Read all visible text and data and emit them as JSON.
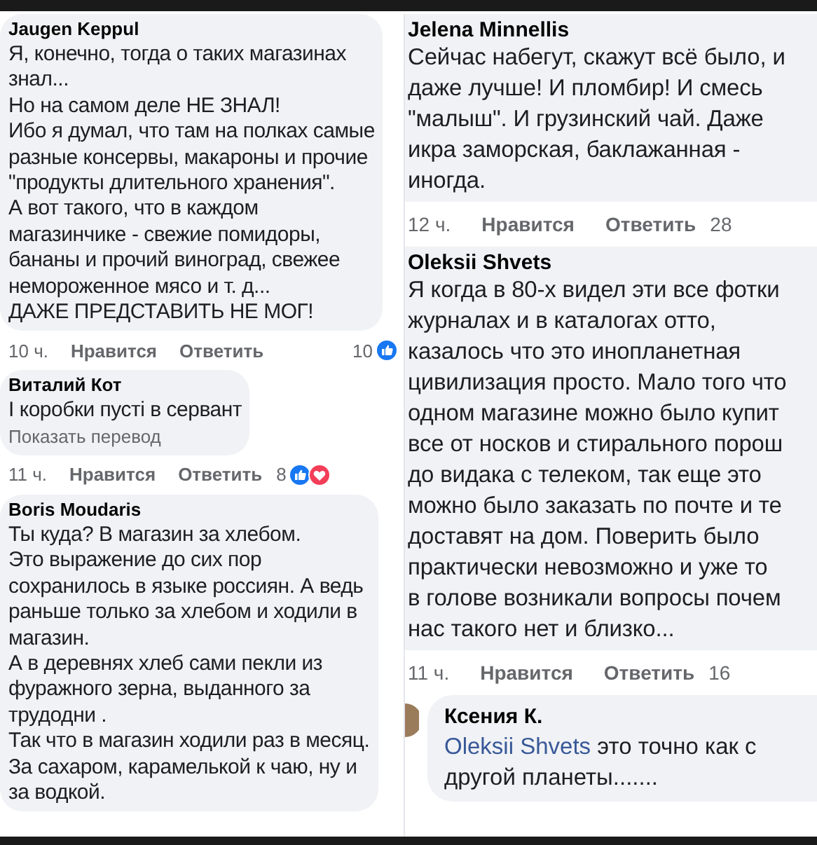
{
  "left": {
    "comments": [
      {
        "author": "Jaugen Keppul",
        "lines": [
          "Я, конечно, тогда о таких магазинах",
          "знал...",
          "Но на самом деле НЕ ЗНАЛ!",
          "Ибо я думал, что там на полках самые",
          "разные консервы, макароны и прочие",
          "\"продукты длительного хранения\".",
          "А вот такого, что в каждом",
          "магазинчике - свежие помидоры,",
          "бананы и прочий виноград, свежее",
          "немороженное мясо и т. д...",
          "ДАЖЕ ПРЕДСТАВИТЬ НЕ МОГ!"
        ],
        "meta": {
          "time": "10 ч.",
          "like": "Нравится",
          "reply": "Ответить",
          "count": "10"
        },
        "reactions": [
          {
            "kind": "like"
          }
        ]
      },
      {
        "author": "Виталий Кот",
        "lines": [
          "І коробки пусті в сервант"
        ],
        "translate": "Показать перевод",
        "meta": {
          "time": "11 ч.",
          "like": "Нравится",
          "reply": "Ответить",
          "count": "8"
        },
        "reactions": [
          {
            "kind": "like"
          },
          {
            "kind": "love"
          }
        ]
      },
      {
        "author": "Boris Moudaris",
        "lines": [
          "Ты куда? В магазин за хлебом.",
          "Это выражение до сих пор",
          "сохранилось в языке россиян. А ведь",
          "раньше только за хлебом и ходили в",
          "магазин.",
          "А в деревнях хлеб сами пекли из",
          "фуражного зерна, выданного за",
          "трудодни .",
          "Так что в магазин ходили раз в месяц.",
          "За сахаром, карамелькой к чаю, ну и",
          "за водкой."
        ]
      }
    ]
  },
  "right": {
    "comments": [
      {
        "author": "Jelena Minnellis",
        "lines": [
          "Сейчас набегут, скажут   всё было, и",
          "даже лучше! И пломбир! И смесь",
          "\"малыш\". И грузинский чай. Даже",
          "икра заморская, баклажанная -",
          "иногда."
        ],
        "meta": {
          "time": "12 ч.",
          "like": "Нравится",
          "reply": "Ответить",
          "count": "28"
        }
      },
      {
        "author": "Oleksii Shvets",
        "lines": [
          "Я когда в 80-х видел эти все фотки",
          "журналах и в каталогах отто,",
          "казалось что это инопланетная",
          "цивилизация просто. Мало того что",
          "одном магазине можно было купит",
          "все от носков и стирального порош",
          "до видака с телеком, так еще это",
          "можно было заказать по почте и те",
          "доставят на дом. Поверить было",
          "практически невозможно и  уже то",
          "в голове возникали вопросы почем",
          "нас такого нет и близко..."
        ],
        "meta": {
          "time": "11 ч.",
          "like": "Нравится",
          "reply": "Ответить",
          "count": "16"
        }
      }
    ],
    "reply": {
      "author": "Ксения К.",
      "mention": "Oleksii Shvets",
      "lines": [
        "это точно как с",
        "другой планеты......."
      ]
    }
  }
}
